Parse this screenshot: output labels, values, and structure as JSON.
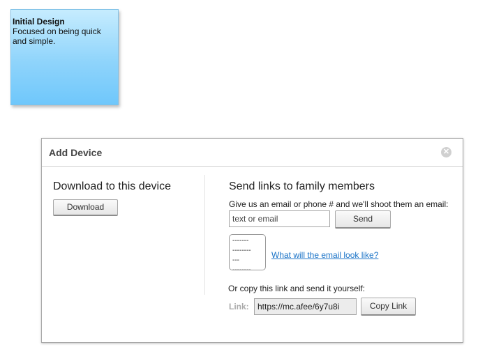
{
  "note": {
    "title": "Initial Design",
    "body": "Focused on being quick and simple."
  },
  "dialog": {
    "title": "Add Device",
    "close_icon": "close-icon",
    "download": {
      "heading": "Download to this device",
      "button_label": "Download"
    },
    "send": {
      "heading": "Send links to family members",
      "instructions": "Give us an email or phone # and we'll shoot them an email:",
      "input_placeholder": "text or email",
      "send_label": "Send",
      "preview_lines": [
        "-------",
        "--------",
        "---",
        "--------"
      ],
      "preview_link": "What will the email look like?",
      "copy_instructions": "Or copy this link and send it yourself:",
      "link_label": "Link:",
      "link_value": "https://mc.afee/6y7u8i",
      "copy_label": "Copy Link"
    }
  }
}
